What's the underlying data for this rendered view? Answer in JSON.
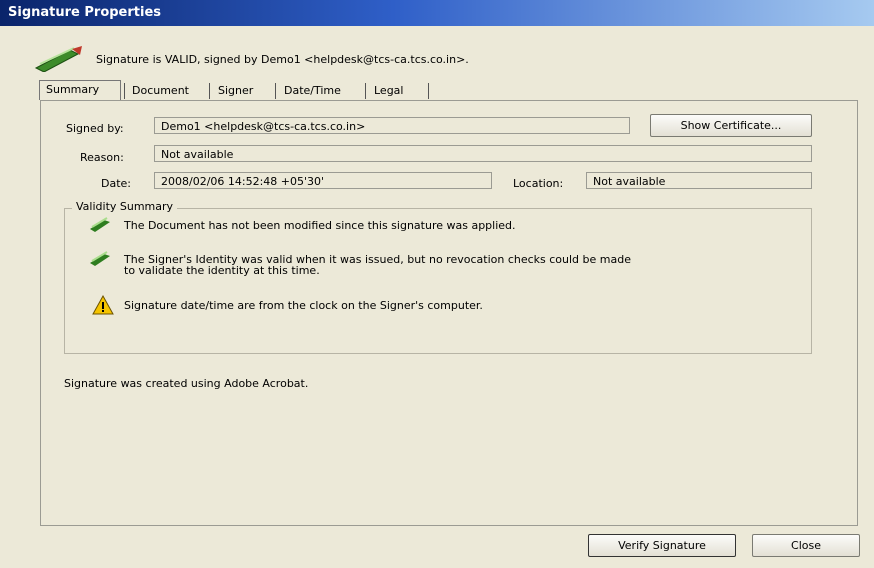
{
  "window": {
    "title": "Signature Properties"
  },
  "header": {
    "icon": "pen-signature-icon",
    "status_text": "Signature is VALID, signed by Demo1 <helpdesk@tcs-ca.tcs.co.in>."
  },
  "tabs": [
    {
      "label": "Summary",
      "selected": true
    },
    {
      "label": "Document"
    },
    {
      "label": "Signer"
    },
    {
      "label": "Date/Time"
    },
    {
      "label": "Legal"
    }
  ],
  "summary": {
    "signed_by_label": "Signed by:",
    "signed_by_value": "Demo1 <helpdesk@tcs-ca.tcs.co.in>",
    "show_certificate_label": "Show Certificate...",
    "reason_label": "Reason:",
    "reason_value": "Not available",
    "date_label": "Date:",
    "date_value": "2008/02/06 14:52:48 +05'30'",
    "location_label": "Location:",
    "location_value": "Not available"
  },
  "validity": {
    "title": "Validity Summary",
    "items": [
      {
        "icon": "green-check-pen-icon",
        "text": "The Document has not been modified since this signature was applied."
      },
      {
        "icon": "green-check-pen-icon",
        "text_line1": "The Signer's Identity was valid when it was issued, but no revocation checks could be made",
        "text_line2": "to validate the identity at this time."
      },
      {
        "icon": "warning-triangle-icon",
        "text": "Signature date/time are from the clock on the Signer's computer."
      }
    ]
  },
  "footer_note": "Signature was created using Adobe Acrobat.",
  "buttons": {
    "verify": "Verify Signature",
    "close": "Close"
  },
  "colors": {
    "titlebar": "#0a246a",
    "dialog_bg": "#ece9d8",
    "valid_green": "#2e7d1f",
    "warning_yellow": "#f5c400"
  }
}
